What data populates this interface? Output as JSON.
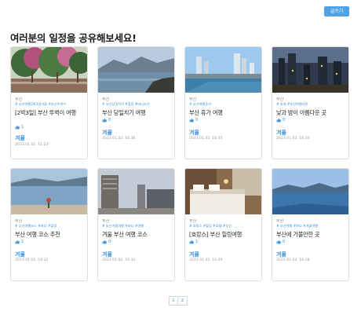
{
  "header": {
    "write_button": "글쓰기",
    "page_title": "여러분의 일정을 공유해보세요!"
  },
  "cards": [
    {
      "region": "부산",
      "tags": "# 부산여행2박3일가을 #부산뚜벅이",
      "title": "[2박3일] 부산 뚜벅이 여행",
      "likes": "1",
      "season": "겨울",
      "date": "2023.01.02. 11:23",
      "photo": "trees"
    },
    {
      "region": "부산",
      "tags": "# 부산당일치기 #힐링 #바다사진",
      "title": "부산 당일치기 여행",
      "likes": "0",
      "season": "겨울",
      "date": "2023.01.02. 16:36",
      "photo": "coast"
    },
    {
      "region": "부산",
      "tags": "# 부산여행휴가",
      "title": "부산 휴가 여행",
      "likes": "0",
      "season": "겨울",
      "date": "2023.01.02. 16:35",
      "photo": "city"
    },
    {
      "region": "부산",
      "tags": "# 야경 #부산여행사진",
      "title": "낮과 밤이 아름다운 곳",
      "likes": "0",
      "season": "겨울",
      "date": "2023.01.02. 16:34",
      "photo": "night"
    },
    {
      "region": "부산",
      "tags": "# 부산여행코스 #바다 #힐링",
      "title": "부산 여행 코스 추천",
      "likes": "1",
      "season": "겨울",
      "date": "2023.01.02. 16:32",
      "photo": "sea"
    },
    {
      "region": "부산",
      "tags": "# 부산겨울여행 #바다 #여행",
      "title": "겨울 부산 여행 코스",
      "likes": "0",
      "season": "겨울",
      "date": "2023.01.02. 16:31",
      "photo": "building"
    },
    {
      "region": "부산",
      "tags": "# 호캉스 #힐링 #호텔 #부산",
      "title": "[호캉스] 부산 힐링여행",
      "likes": "1",
      "season": "겨울",
      "date": "2023.01.02. 16:29",
      "photo": "hotel"
    },
    {
      "region": "부산",
      "tags": "# 부산여행 #바다 #겨울여행",
      "title": "부산에 가볼만한 곳",
      "likes": "0",
      "season": "겨울",
      "date": "2023.01.02. 16:28",
      "photo": "bay"
    }
  ],
  "pagination": {
    "pages": [
      "1",
      "2"
    ]
  }
}
